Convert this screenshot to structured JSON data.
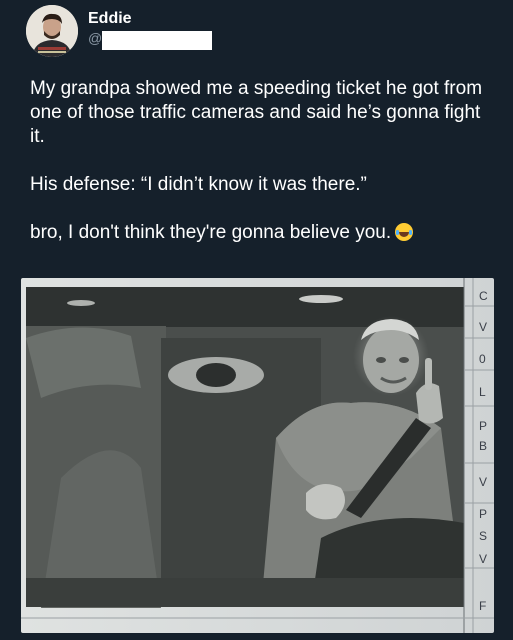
{
  "user": {
    "display_name": "Eddie",
    "handle_visible": "@r"
  },
  "tweet": {
    "paragraphs": [
      "My grandpa showed me a speeding ticket he got from one of those traffic cameras and said he’s gonna fight it.",
      "His defense: “I didn’t know it was there.”",
      "bro, I don't think they're gonna believe you."
    ],
    "emoji": "face-with-tears-of-joy-emoji"
  },
  "photo": {
    "form_side_letters": [
      "C",
      "V",
      "0",
      "L",
      "P",
      "B",
      "V",
      "P",
      "S",
      "V",
      "F"
    ]
  },
  "colors": {
    "background": "#15202b",
    "text": "#ffffff",
    "secondary_text": "#8b98a5"
  }
}
